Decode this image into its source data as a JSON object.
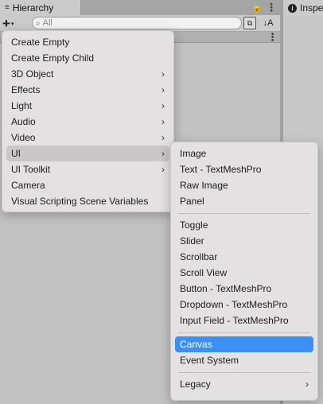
{
  "hierarchy": {
    "tab_icon": "≡",
    "tab_label": "Hierarchy",
    "lock_icon": "🔓",
    "kebab": "⋮",
    "add_button": "+",
    "add_caret": "▾",
    "search_placeholder": "All",
    "search_value": "",
    "search_glyph": "⌕",
    "filter_glyph": "⧉",
    "sort_glyph": "↓A",
    "scene_kebab": "⋮"
  },
  "inspector": {
    "tab_label": "Inspe",
    "info_glyph": "i"
  },
  "main_menu": {
    "arrow": "›",
    "items": [
      {
        "label": "Create Empty",
        "submenu": false
      },
      {
        "label": "Create Empty Child",
        "submenu": false
      },
      {
        "label": "3D Object",
        "submenu": true
      },
      {
        "label": "Effects",
        "submenu": true
      },
      {
        "label": "Light",
        "submenu": true
      },
      {
        "label": "Audio",
        "submenu": true
      },
      {
        "label": "Video",
        "submenu": true
      },
      {
        "label": "UI",
        "submenu": true,
        "highlighted": true
      },
      {
        "label": "UI Toolkit",
        "submenu": true
      },
      {
        "label": "Camera",
        "submenu": false
      },
      {
        "label": "Visual Scripting Scene Variables",
        "submenu": false
      }
    ]
  },
  "ui_submenu": {
    "group1": [
      "Image",
      "Text - TextMeshPro",
      "Raw Image",
      "Panel"
    ],
    "group2": [
      "Toggle",
      "Slider",
      "Scrollbar",
      "Scroll View",
      "Button - TextMeshPro",
      "Dropdown - TextMeshPro",
      "Input Field - TextMeshPro"
    ],
    "group3": [
      "Canvas",
      "Event System"
    ],
    "selected": "Canvas",
    "legacy": "Legacy",
    "arrow": "›"
  },
  "colors": {
    "selection": "#3b8ff5",
    "menu_bg": "#e4e1e3"
  }
}
